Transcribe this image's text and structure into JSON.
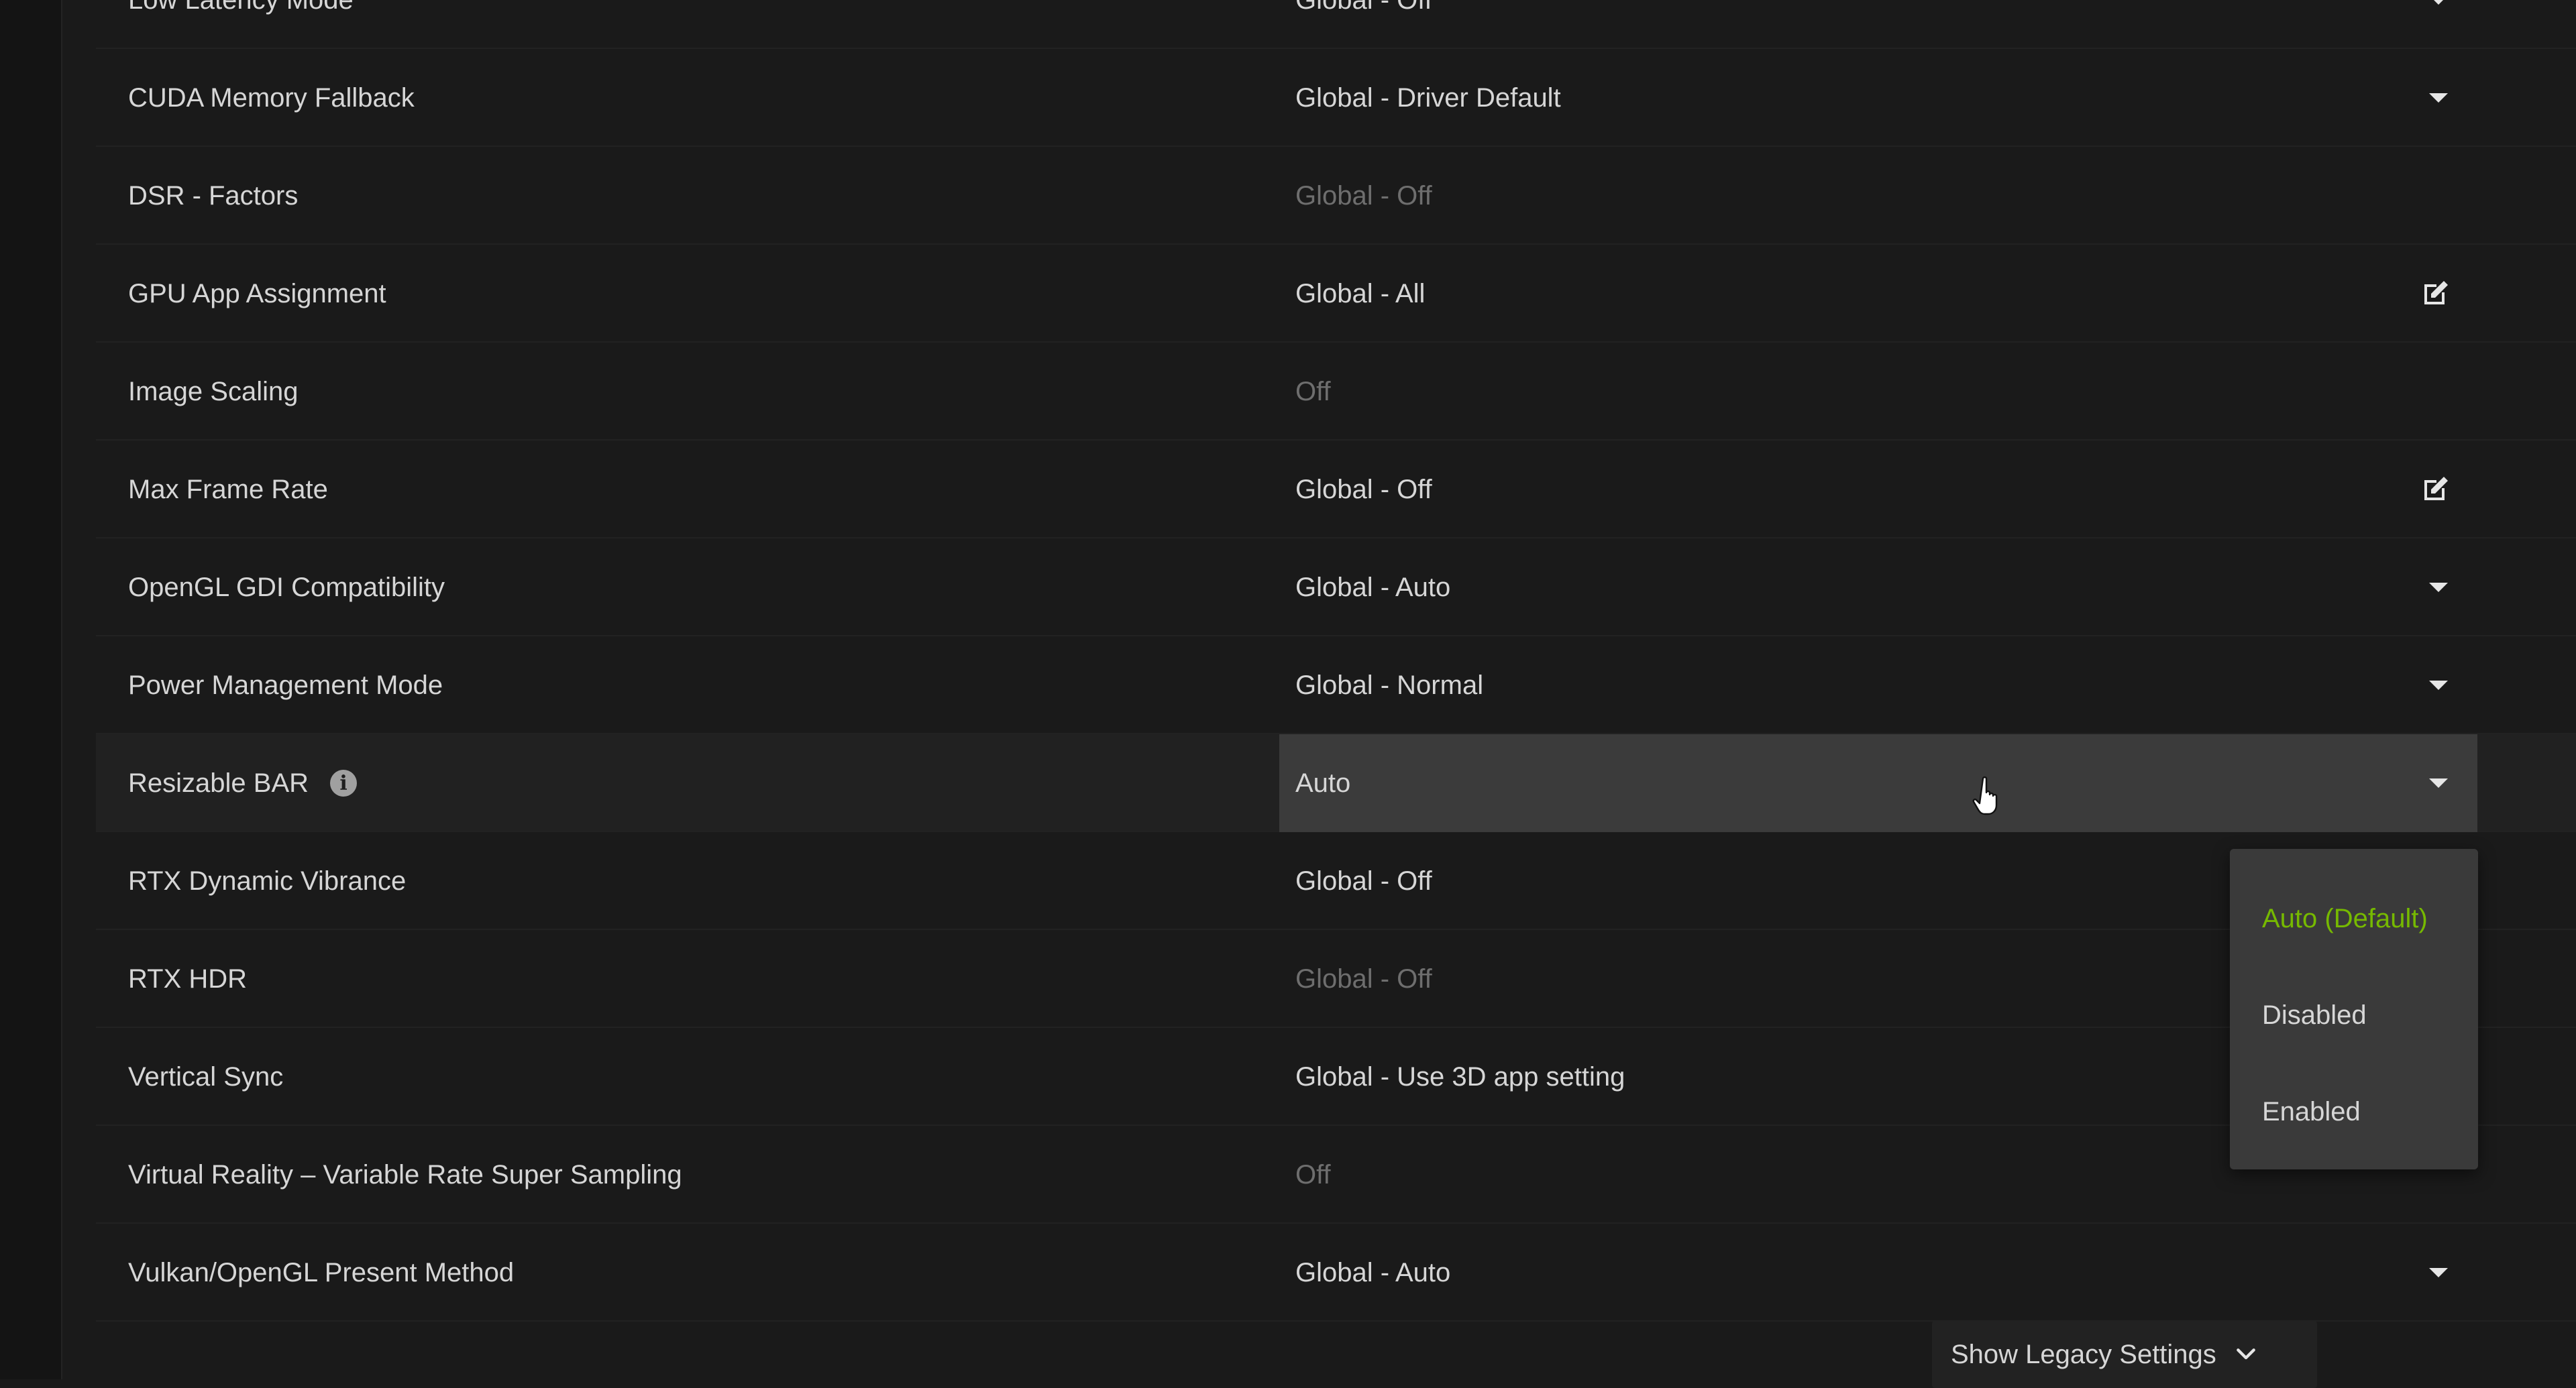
{
  "settings": [
    {
      "name": "Low Latency Mode",
      "value": "Global - Off",
      "control": "dropdown",
      "dim": false
    },
    {
      "name": "CUDA Memory Fallback",
      "value": "Global - Driver Default",
      "control": "dropdown",
      "dim": false
    },
    {
      "name": "DSR - Factors",
      "value": "Global - Off",
      "control": "none",
      "dim": true
    },
    {
      "name": "GPU App Assignment",
      "value": "Global - All",
      "control": "edit",
      "dim": false
    },
    {
      "name": "Image Scaling",
      "value": "Off",
      "control": "none",
      "dim": true
    },
    {
      "name": "Max Frame Rate",
      "value": "Global - Off",
      "control": "edit",
      "dim": false
    },
    {
      "name": "OpenGL GDI Compatibility",
      "value": "Global - Auto",
      "control": "dropdown",
      "dim": false
    },
    {
      "name": "Power Management Mode",
      "value": "Global - Normal",
      "control": "dropdown",
      "dim": false
    },
    {
      "name": "Resizable BAR",
      "value": "Auto",
      "control": "dropdown",
      "dim": false,
      "selected": true,
      "info": true
    },
    {
      "name": "RTX Dynamic Vibrance",
      "value": "Global - Off",
      "control": "dropdown",
      "dim": false
    },
    {
      "name": "RTX HDR",
      "value": "Global - Off",
      "control": "none",
      "dim": true
    },
    {
      "name": "Vertical Sync",
      "value": "Global - Use 3D app setting",
      "control": "dropdown",
      "dim": false
    },
    {
      "name": "Virtual Reality – Variable Rate Super Sampling",
      "value": "Off",
      "control": "none",
      "dim": true
    },
    {
      "name": "Vulkan/OpenGL Present Method",
      "value": "Global - Auto",
      "control": "dropdown",
      "dim": false
    }
  ],
  "dropdown": {
    "options": [
      "Auto (Default)",
      "Disabled",
      "Enabled"
    ],
    "current_index": 0
  },
  "legacy_button": {
    "label": "Show Legacy Settings"
  },
  "colors": {
    "accent": "#76b900",
    "background": "#1a1a1a",
    "selected_value_bg": "#3b3b3b",
    "dim_text": "#6e6e6e"
  },
  "icons": {
    "dropdown": "caret-down-icon",
    "edit": "edit-icon",
    "info": "info-icon",
    "legacy": "chevron-down-icon",
    "cursor": "hand-pointer-cursor"
  }
}
